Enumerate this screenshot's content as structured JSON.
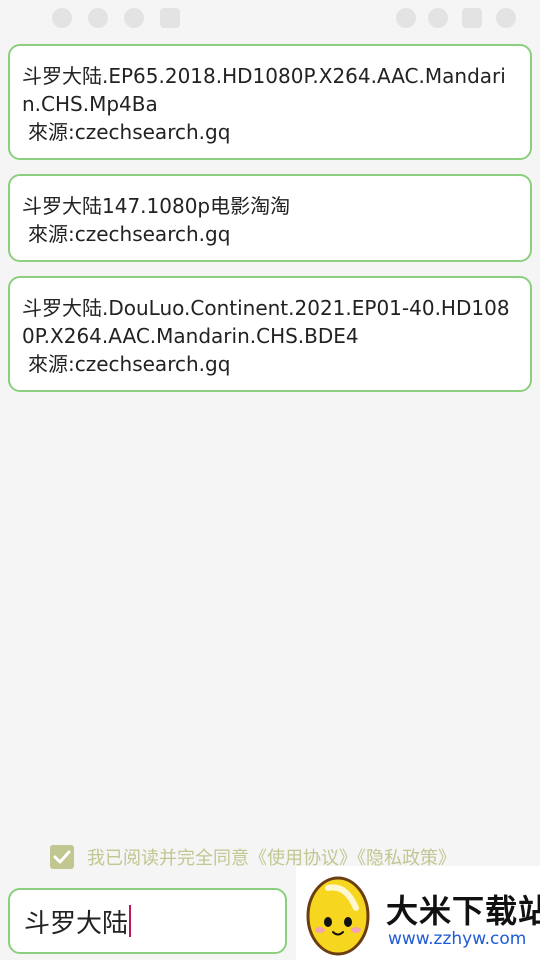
{
  "results": [
    {
      "title": "斗罗大陆.EP65.2018.HD1080P.X264.AAC.Mandarin.CHS.Mp4Ba",
      "source": "來源:czechsearch.gq"
    },
    {
      "title": "斗罗大陆147.1080p电影淘淘",
      "source": "來源:czechsearch.gq"
    },
    {
      "title": "斗罗大陆.DouLuo.Continent.2021.EP01-40.HD1080P.X264.AAC.Mandarin.CHS.BDE4",
      "source": "來源:czechsearch.gq"
    }
  ],
  "agreement": {
    "checked": true,
    "text": "我已阅读并完全同意《使用协议》《隐私政策》"
  },
  "search": {
    "value": "斗罗大陆"
  },
  "watermark": {
    "name": "大米下载站",
    "url": "www.zzhyw.com"
  },
  "colors": {
    "card_border": "#8ccf7e",
    "agree_text": "#c2c691",
    "caret": "#c2185b",
    "url": "#1f5bd6"
  }
}
